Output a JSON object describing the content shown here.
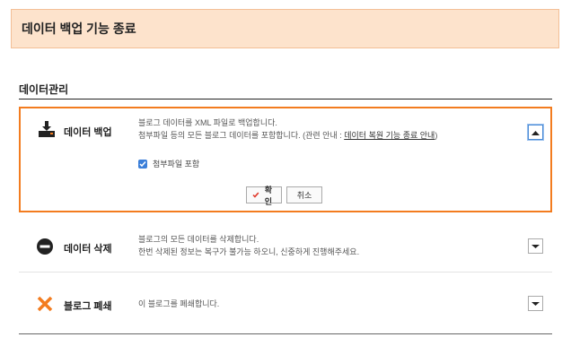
{
  "notice": {
    "text": "데이터 백업 기능 종료"
  },
  "section": {
    "title": "데이터관리"
  },
  "rows": [
    {
      "label": "데이터 백업",
      "icon": "download-tray-icon",
      "desc_line1": "블로그 데이터를 XML 파일로 백업합니다.",
      "desc_line2_prefix": "첨부파일 등의 모든 블로그 데이터를 포함합니다. (관련 안내 : ",
      "desc_link": "데이터 복원 기능 종료 안내",
      "desc_line2_suffix": ")",
      "checkbox_label": "첨부파일 포함",
      "checkbox_checked": true,
      "confirm_label": "확인",
      "cancel_label": "취소",
      "expanded": true
    },
    {
      "label": "데이터 삭제",
      "icon": "minus-circle-icon",
      "desc_line1": "블로그의 모든 데이터를 삭제합니다.",
      "desc_line2": "한번 삭제된 정보는 복구가 불가능 하오니, 신중하게 진행해주세요."
    },
    {
      "label": "블로그 폐쇄",
      "icon": "close-x-icon",
      "desc_line1": "이 블로그를 폐쇄합니다."
    }
  ],
  "colors": {
    "accent": "#f37c1f",
    "notice_bg": "#fde3cc",
    "checkbox": "#3b7fd9",
    "confirm_check": "#e0392b"
  }
}
